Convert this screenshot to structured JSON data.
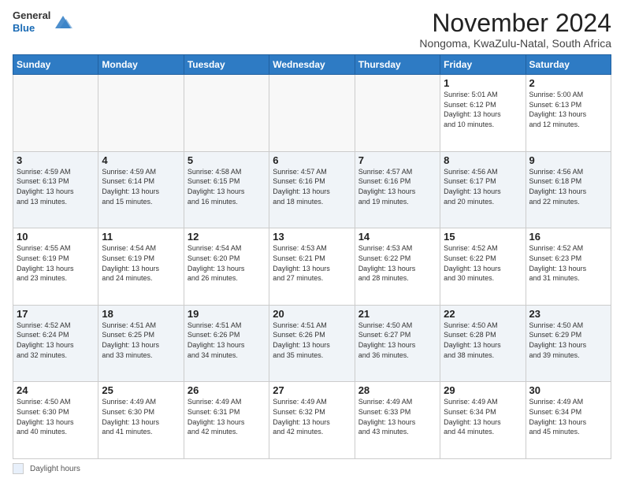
{
  "logo": {
    "general": "General",
    "blue": "Blue"
  },
  "header": {
    "title": "November 2024",
    "subtitle": "Nongoma, KwaZulu-Natal, South Africa"
  },
  "columns": [
    "Sunday",
    "Monday",
    "Tuesday",
    "Wednesday",
    "Thursday",
    "Friday",
    "Saturday"
  ],
  "weeks": [
    [
      {
        "day": "",
        "info": ""
      },
      {
        "day": "",
        "info": ""
      },
      {
        "day": "",
        "info": ""
      },
      {
        "day": "",
        "info": ""
      },
      {
        "day": "",
        "info": ""
      },
      {
        "day": "1",
        "info": "Sunrise: 5:01 AM\nSunset: 6:12 PM\nDaylight: 13 hours\nand 10 minutes."
      },
      {
        "day": "2",
        "info": "Sunrise: 5:00 AM\nSunset: 6:13 PM\nDaylight: 13 hours\nand 12 minutes."
      }
    ],
    [
      {
        "day": "3",
        "info": "Sunrise: 4:59 AM\nSunset: 6:13 PM\nDaylight: 13 hours\nand 13 minutes."
      },
      {
        "day": "4",
        "info": "Sunrise: 4:59 AM\nSunset: 6:14 PM\nDaylight: 13 hours\nand 15 minutes."
      },
      {
        "day": "5",
        "info": "Sunrise: 4:58 AM\nSunset: 6:15 PM\nDaylight: 13 hours\nand 16 minutes."
      },
      {
        "day": "6",
        "info": "Sunrise: 4:57 AM\nSunset: 6:16 PM\nDaylight: 13 hours\nand 18 minutes."
      },
      {
        "day": "7",
        "info": "Sunrise: 4:57 AM\nSunset: 6:16 PM\nDaylight: 13 hours\nand 19 minutes."
      },
      {
        "day": "8",
        "info": "Sunrise: 4:56 AM\nSunset: 6:17 PM\nDaylight: 13 hours\nand 20 minutes."
      },
      {
        "day": "9",
        "info": "Sunrise: 4:56 AM\nSunset: 6:18 PM\nDaylight: 13 hours\nand 22 minutes."
      }
    ],
    [
      {
        "day": "10",
        "info": "Sunrise: 4:55 AM\nSunset: 6:19 PM\nDaylight: 13 hours\nand 23 minutes."
      },
      {
        "day": "11",
        "info": "Sunrise: 4:54 AM\nSunset: 6:19 PM\nDaylight: 13 hours\nand 24 minutes."
      },
      {
        "day": "12",
        "info": "Sunrise: 4:54 AM\nSunset: 6:20 PM\nDaylight: 13 hours\nand 26 minutes."
      },
      {
        "day": "13",
        "info": "Sunrise: 4:53 AM\nSunset: 6:21 PM\nDaylight: 13 hours\nand 27 minutes."
      },
      {
        "day": "14",
        "info": "Sunrise: 4:53 AM\nSunset: 6:22 PM\nDaylight: 13 hours\nand 28 minutes."
      },
      {
        "day": "15",
        "info": "Sunrise: 4:52 AM\nSunset: 6:22 PM\nDaylight: 13 hours\nand 30 minutes."
      },
      {
        "day": "16",
        "info": "Sunrise: 4:52 AM\nSunset: 6:23 PM\nDaylight: 13 hours\nand 31 minutes."
      }
    ],
    [
      {
        "day": "17",
        "info": "Sunrise: 4:52 AM\nSunset: 6:24 PM\nDaylight: 13 hours\nand 32 minutes."
      },
      {
        "day": "18",
        "info": "Sunrise: 4:51 AM\nSunset: 6:25 PM\nDaylight: 13 hours\nand 33 minutes."
      },
      {
        "day": "19",
        "info": "Sunrise: 4:51 AM\nSunset: 6:26 PM\nDaylight: 13 hours\nand 34 minutes."
      },
      {
        "day": "20",
        "info": "Sunrise: 4:51 AM\nSunset: 6:26 PM\nDaylight: 13 hours\nand 35 minutes."
      },
      {
        "day": "21",
        "info": "Sunrise: 4:50 AM\nSunset: 6:27 PM\nDaylight: 13 hours\nand 36 minutes."
      },
      {
        "day": "22",
        "info": "Sunrise: 4:50 AM\nSunset: 6:28 PM\nDaylight: 13 hours\nand 38 minutes."
      },
      {
        "day": "23",
        "info": "Sunrise: 4:50 AM\nSunset: 6:29 PM\nDaylight: 13 hours\nand 39 minutes."
      }
    ],
    [
      {
        "day": "24",
        "info": "Sunrise: 4:50 AM\nSunset: 6:30 PM\nDaylight: 13 hours\nand 40 minutes."
      },
      {
        "day": "25",
        "info": "Sunrise: 4:49 AM\nSunset: 6:30 PM\nDaylight: 13 hours\nand 41 minutes."
      },
      {
        "day": "26",
        "info": "Sunrise: 4:49 AM\nSunset: 6:31 PM\nDaylight: 13 hours\nand 42 minutes."
      },
      {
        "day": "27",
        "info": "Sunrise: 4:49 AM\nSunset: 6:32 PM\nDaylight: 13 hours\nand 42 minutes."
      },
      {
        "day": "28",
        "info": "Sunrise: 4:49 AM\nSunset: 6:33 PM\nDaylight: 13 hours\nand 43 minutes."
      },
      {
        "day": "29",
        "info": "Sunrise: 4:49 AM\nSunset: 6:34 PM\nDaylight: 13 hours\nand 44 minutes."
      },
      {
        "day": "30",
        "info": "Sunrise: 4:49 AM\nSunset: 6:34 PM\nDaylight: 13 hours\nand 45 minutes."
      }
    ]
  ],
  "legend": {
    "box_label": "Daylight hours"
  }
}
